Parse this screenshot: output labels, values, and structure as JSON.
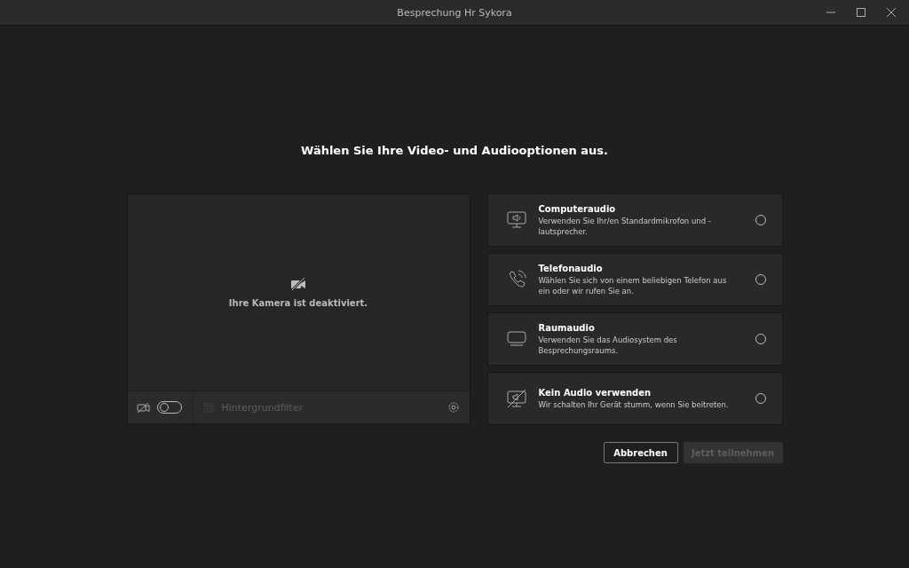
{
  "window": {
    "title": "Besprechung Hr Sykora"
  },
  "heading": "Wählen Sie Ihre Video- und Audiooptionen aus.",
  "camera": {
    "message": "Ihre Kamera ist deaktiviert.",
    "on": false,
    "filter_label": "Hintergrundfilter",
    "filter_disabled": true
  },
  "audio_options": [
    {
      "kind": "computer",
      "title": "Computeraudio",
      "description": "Verwenden Sie Ihr/en Standardmikrofon und -lautsprecher.",
      "selected": false
    },
    {
      "kind": "phone",
      "title": "Telefonaudio",
      "description": "Wählen Sie sich von einem beliebigen Telefon aus ein oder wir rufen Sie an.",
      "selected": false
    },
    {
      "kind": "room",
      "title": "Raumaudio",
      "description": "Verwenden Sie das Audiosystem des Besprechungsraums.",
      "selected": false
    },
    {
      "kind": "none",
      "title": "Kein Audio verwenden",
      "description": "Wir schalten Ihr Gerät stumm, wenn Sie beitreten.",
      "selected": false
    }
  ],
  "buttons": [
    {
      "label": "Abbrechen",
      "disabled": false
    },
    {
      "label": "Jetzt teilnehmen",
      "disabled": true
    }
  ]
}
